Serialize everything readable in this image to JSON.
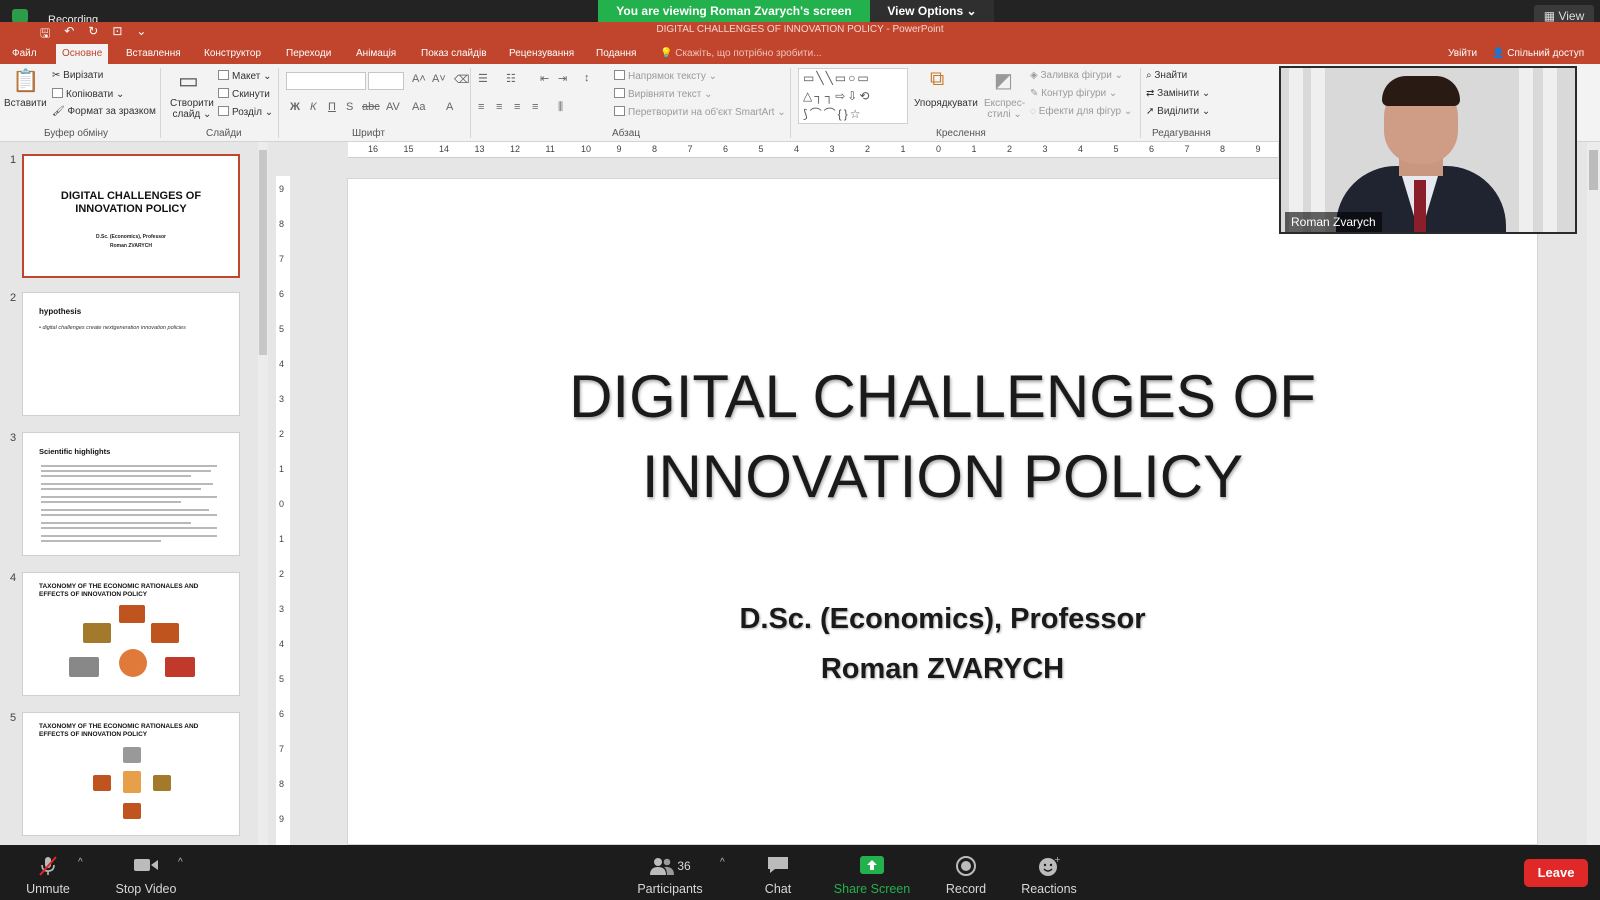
{
  "zoom": {
    "share_banner": "You are viewing Roman Zvarych's screen",
    "view_options": "View Options",
    "view_button": "View",
    "recording_label": "Recording",
    "toolbar": {
      "unmute": "Unmute",
      "stop_video": "Stop Video",
      "participants": "Participants",
      "participant_count": "36",
      "chat": "Chat",
      "share_screen": "Share Screen",
      "record": "Record",
      "reactions": "Reactions",
      "leave": "Leave"
    },
    "video_name": "Roman Zvarych",
    "colors": {
      "share_green": "#23b14d",
      "leave_red": "#e02828"
    }
  },
  "ppt": {
    "window_title": "DIGITAL CHALLENGES OF INNOVATION POLICY - PowerPoint",
    "tabs": [
      "Файл",
      "Основне",
      "Вставлення",
      "Конструктор",
      "Переходи",
      "Анімація",
      "Показ слайдів",
      "Рецензування",
      "Подання"
    ],
    "active_tab": "Основне",
    "tell_me": "Скажіть, що потрібно зробити...",
    "sign_in": "Увійти",
    "share_access": "Спільний доступ",
    "accent_color": "#c1442c",
    "ribbon": {
      "clipboard": {
        "paste": "Вставити",
        "cut": "Вирізати",
        "copy": "Копіювати",
        "format_painter": "Формат за зразком",
        "label": "Буфер обміну"
      },
      "slides": {
        "new_slide_line1": "Створити",
        "new_slide_line2": "слайд",
        "layout": "Макет",
        "reset": "Скинути",
        "section": "Розділ",
        "label": "Слайди"
      },
      "font": {
        "label": "Шрифт"
      },
      "paragraph": {
        "text_direction": "Напрямок тексту",
        "align_text": "Вирівняти текст",
        "convert_smartart": "Перетворити на об'єкт SmartArt",
        "label": "Абзац"
      },
      "drawing": {
        "arrange": "Упорядкувати",
        "quick_styles_line1": "Експрес-",
        "quick_styles_line2": "стилі",
        "shape_fill": "Заливка фігури",
        "shape_outline": "Контур фігури",
        "shape_effects": "Ефекти для фігур",
        "label": "Креслення"
      },
      "editing": {
        "find": "Знайти",
        "replace": "Замінити",
        "select": "Виділити",
        "label": "Редагування"
      }
    },
    "slides": [
      {
        "num": "1",
        "title": "DIGITAL CHALLENGES OF INNOVATION POLICY",
        "sub1": "D.Sc. (Economics), Professor",
        "sub2": "Roman ZVARYCH"
      },
      {
        "num": "2",
        "title": "hypothesis",
        "bullet": "• digital challenges create nextgeneration innovation policies"
      },
      {
        "num": "3",
        "title": "Scientific highlights"
      },
      {
        "num": "4",
        "title": "TAXONOMY OF THE ECONOMIC RATIONALES AND EFFECTS OF INNOVATION POLICY"
      },
      {
        "num": "5",
        "title": "TAXONOMY OF THE ECONOMIC RATIONALES AND EFFECTS OF INNOVATION POLICY"
      }
    ],
    "current_slide": {
      "title": "DIGITAL CHALLENGES OF INNOVATION POLICY",
      "title_line1": "DIGITAL CHALLENGES OF",
      "title_line2": "INNOVATION POLICY",
      "subtitle_line1": "D.Sc. (Economics), Professor",
      "subtitle_line2": "Roman ZVARYCH"
    },
    "ruler_marks": [
      "16",
      "15",
      "14",
      "13",
      "12",
      "11",
      "10",
      "9",
      "8",
      "7",
      "6",
      "5",
      "4",
      "3",
      "2",
      "1",
      "0",
      "1",
      "2",
      "3",
      "4",
      "5",
      "6",
      "7",
      "8",
      "9"
    ]
  }
}
